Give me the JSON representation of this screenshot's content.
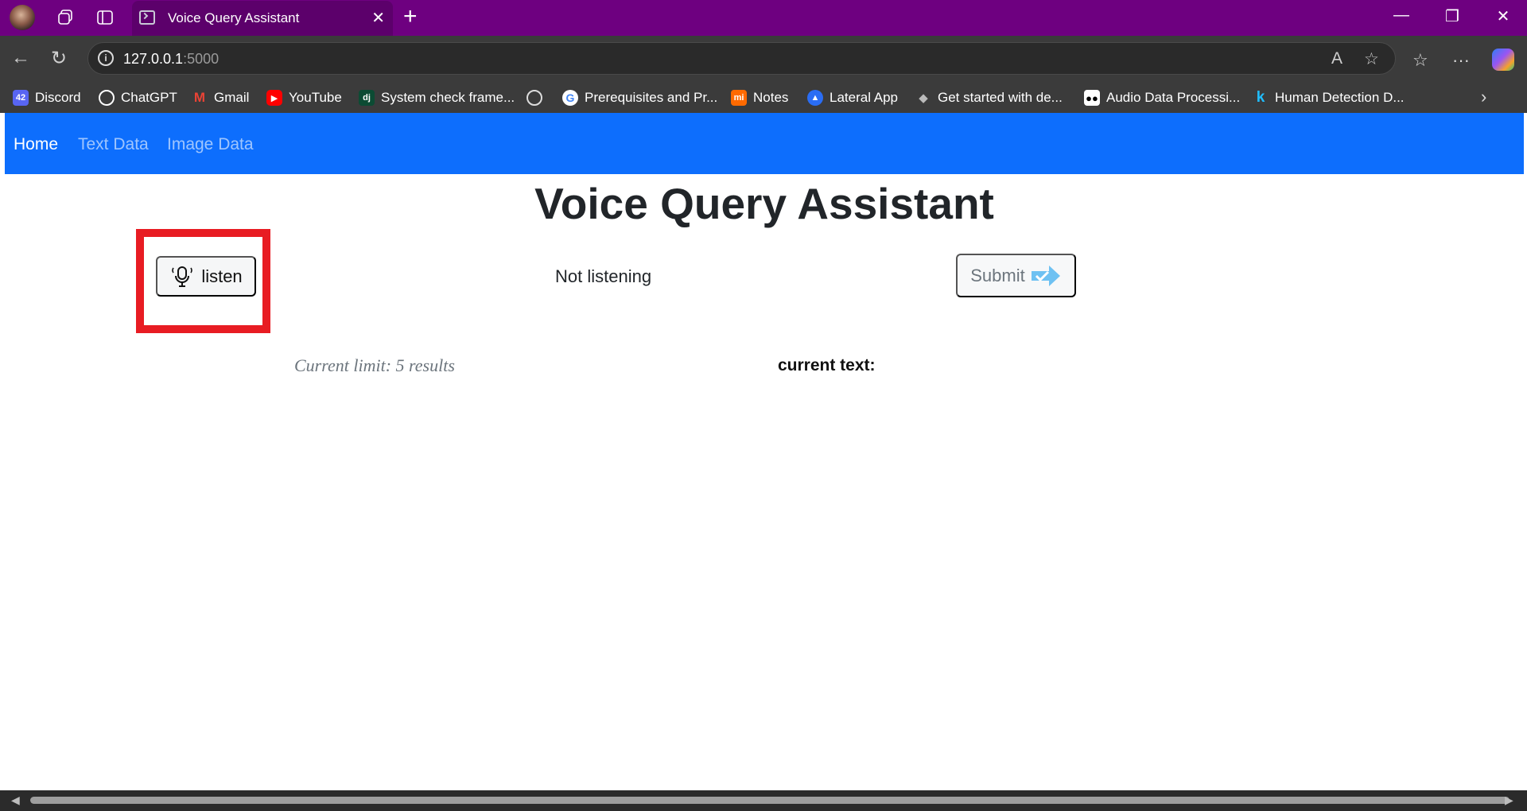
{
  "browser": {
    "tab_title": "Voice Query Assistant",
    "url_host": "127.0.0.1",
    "url_port": ":5000",
    "bookmarks": [
      {
        "label": "Discord",
        "icon": "discord-icon",
        "color": "#5865f2",
        "badge": "42"
      },
      {
        "label": "ChatGPT",
        "icon": "chatgpt-icon",
        "color": "#2b2b2b"
      },
      {
        "label": "Gmail",
        "icon": "gmail-icon",
        "color": "#ea4335"
      },
      {
        "label": "YouTube",
        "icon": "youtube-icon",
        "color": "#ff0000"
      },
      {
        "label": "System check frame...",
        "icon": "django-icon",
        "color": "#0c4b33"
      },
      {
        "label": "",
        "icon": "globe-icon",
        "color": "#3b3b3b"
      },
      {
        "label": "Prerequisites and Pr...",
        "icon": "google-icon",
        "color": "#ffffff"
      },
      {
        "label": "Notes",
        "icon": "notes-icon",
        "color": "#ff6a00"
      },
      {
        "label": "Lateral App",
        "icon": "lateral-icon",
        "color": "#2a6df4"
      },
      {
        "label": "Get started with de...",
        "icon": "docker-icon",
        "color": "#3b3b3b"
      },
      {
        "label": "Audio Data Processi...",
        "icon": "medium-icon",
        "color": "#000000"
      },
      {
        "label": "Human Detection D...",
        "icon": "kaggle-icon",
        "color": "#3b3b3b"
      }
    ]
  },
  "navbar": {
    "items": [
      "Home",
      "Text Data",
      "Image Data"
    ],
    "active": "Home",
    "color": "#0d6efd"
  },
  "main": {
    "title": "Voice Query Assistant",
    "listen_label": "listen",
    "status": "Not listening",
    "submit_label": "Submit",
    "limit_text": "Current limit: 5 results",
    "current_text_label": "current text:"
  },
  "highlight_color": "#e81c23"
}
